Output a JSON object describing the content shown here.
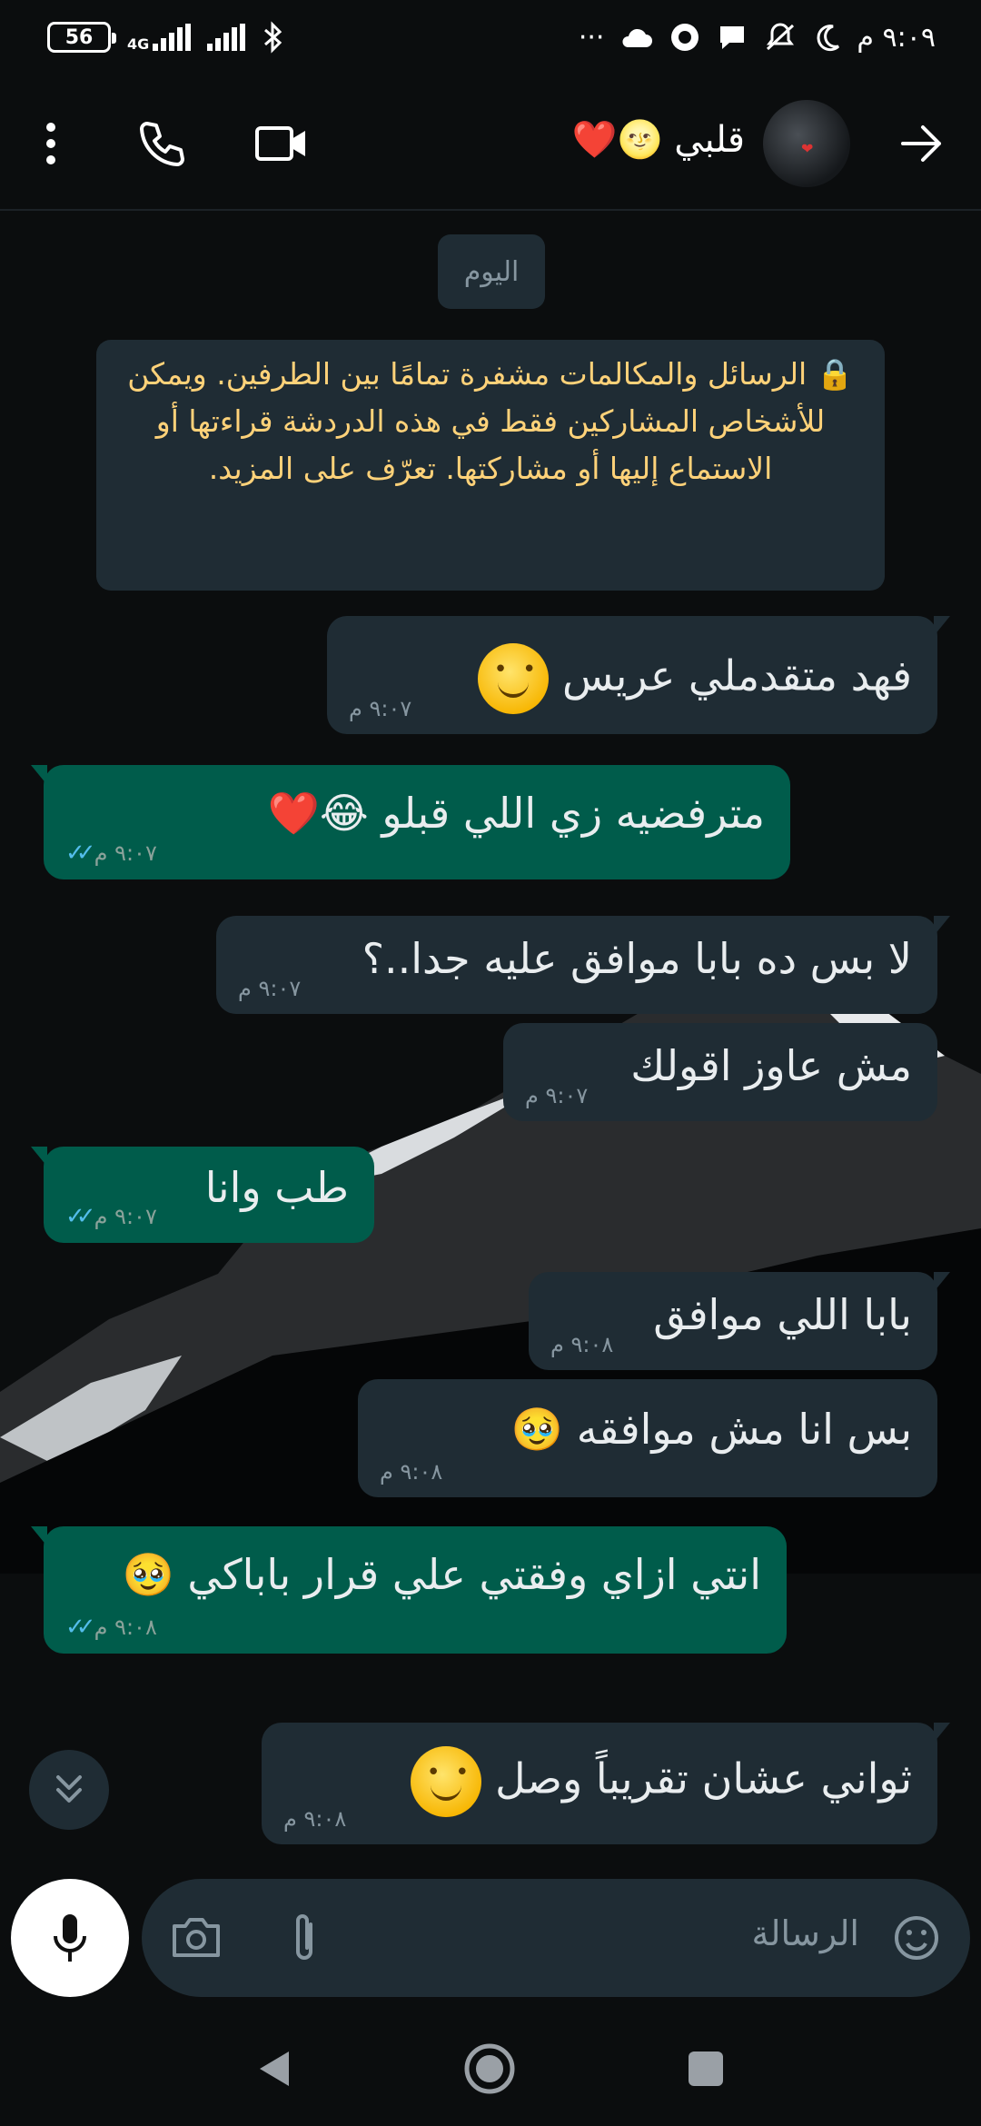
{
  "status_bar": {
    "battery": "56",
    "network": "4G",
    "time": "٩:٠٩ م",
    "icons": [
      "battery-icon",
      "signal-icon",
      "bluetooth-icon",
      "more-dots-icon",
      "cloud-icon",
      "notification-icon",
      "chat-icon",
      "mute-icon",
      "moon-icon"
    ]
  },
  "header": {
    "contact_name": "قلبي 🌝❤️",
    "icons": [
      "back-arrow-icon",
      "video-call-icon",
      "voice-call-icon",
      "menu-dots-icon"
    ]
  },
  "chat": {
    "date_chip": "اليوم",
    "encryption_notice": "🔒 الرسائل والمكالمات مشفرة تمامًا بين الطرفين. ويمكن للأشخاص المشاركين فقط في هذه الدردشة قراءتها أو الاستماع إليها أو مشاركتها. تعرّف على المزيد.",
    "messages": [
      {
        "direction": "in",
        "text": "فهد متقدملي عريس",
        "emoji": "🙂",
        "time": "٩:٠٧ م"
      },
      {
        "direction": "out",
        "text": "مترفضيه زي اللي قبلو 😂❤️",
        "time": "٩:٠٧ م",
        "status": "read"
      },
      {
        "direction": "in",
        "text": "لا بس ده بابا موافق عليه جدا..؟",
        "time": "٩:٠٧ م"
      },
      {
        "direction": "in",
        "text": "مش عاوز اقولك",
        "time": "٩:٠٧ م"
      },
      {
        "direction": "out",
        "text": "طب وانا",
        "time": "٩:٠٧ م",
        "status": "read"
      },
      {
        "direction": "in",
        "text": "بابا اللي موافق",
        "time": "٩:٠٨ م"
      },
      {
        "direction": "in",
        "text": "بس انا مش موافقه 🥹",
        "time": "٩:٠٨ م"
      },
      {
        "direction": "out",
        "text": "انتي ازاي وفقتي علي قرار باباكي 🥹",
        "time": "٩:٠٨ م",
        "status": "read"
      },
      {
        "direction": "in",
        "text": "ثواني عشان تقريباً وصل",
        "emoji": "🙂",
        "time": "٩:٠٨ م"
      }
    ],
    "read_ticks": "✓✓"
  },
  "composer": {
    "placeholder": "الرسالة",
    "icons": [
      "sticker-icon",
      "attach-icon",
      "camera-icon",
      "mic-icon"
    ]
  },
  "colors": {
    "background": "#0b0d0e",
    "incoming_bubble": "#1f2c34",
    "outgoing_bubble": "#005c4b",
    "notice_text": "#ffd279",
    "read_ticks": "#53bdeb"
  }
}
